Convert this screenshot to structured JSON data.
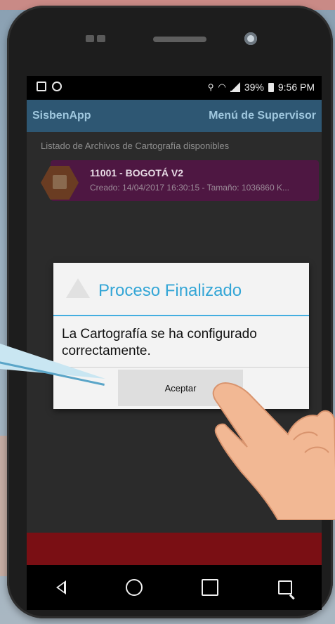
{
  "status_bar": {
    "battery": "39%",
    "time": "9:56 PM"
  },
  "app_bar": {
    "title": "SisbenApp",
    "menu": "Menú de Supervisor"
  },
  "list": {
    "heading": "Listado de Archivos de Cartografía disponibles",
    "items": [
      {
        "title": "11001 - BOGOTÁ V2",
        "meta": "Creado: 14/04/2017 16:30:15 - Tamaño: 1036860 K..."
      }
    ]
  },
  "dialog": {
    "title": "Proceso Finalizado",
    "message": "La Cartografía se ha configurado correctamente.",
    "button": "Aceptar"
  },
  "colors": {
    "app_bar": "#2e5773",
    "list_item": "#4e1742",
    "dialog_accent": "#44aee0",
    "footer": "#7a0f14"
  },
  "icons": [
    "image-icon",
    "whatsapp-icon",
    "location-icon",
    "wifi-icon",
    "signal-icon",
    "battery-icon",
    "file-icon",
    "warning-icon",
    "back-icon",
    "home-icon",
    "recent-apps-icon",
    "menu-icon"
  ]
}
